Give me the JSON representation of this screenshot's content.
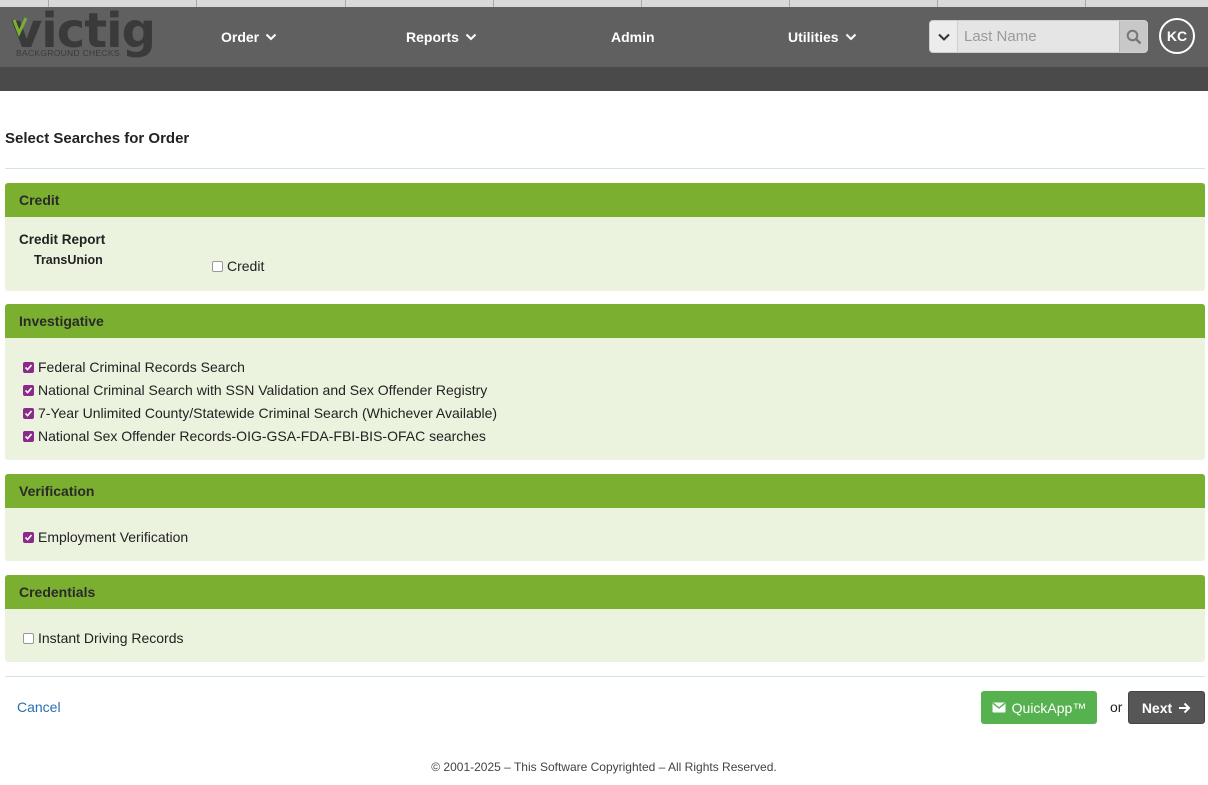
{
  "header": {
    "logo_word": "victig",
    "logo_tagline": "BACKGROUND CHECKS",
    "nav": [
      {
        "label": "Order",
        "has_menu": true
      },
      {
        "label": "Reports",
        "has_menu": true
      },
      {
        "label": "Admin",
        "has_menu": false
      },
      {
        "label": "Utilities",
        "has_menu": true
      }
    ],
    "search": {
      "placeholder": "Last Name",
      "value": ""
    },
    "avatar_initials": "KC"
  },
  "page": {
    "title": "Select Searches for Order"
  },
  "sections": {
    "credit": {
      "title": "Credit",
      "group_label": "Credit Report",
      "provider": "TransUnion",
      "option": {
        "label": "Credit",
        "checked": false
      }
    },
    "investigative": {
      "title": "Investigative",
      "items": [
        {
          "label": "Federal Criminal Records Search",
          "checked": true
        },
        {
          "label": "National Criminal Search with SSN Validation and Sex Offender Registry",
          "checked": true
        },
        {
          "label": "7-Year Unlimited County/Statewide Criminal Search (Whichever Available)",
          "checked": true
        },
        {
          "label": "National Sex Offender Records-OIG-GSA-FDA-FBI-BIS-OFAC searches",
          "checked": true
        }
      ]
    },
    "verification": {
      "title": "Verification",
      "items": [
        {
          "label": "Employment Verification",
          "checked": true
        }
      ]
    },
    "credentials": {
      "title": "Credentials",
      "items": [
        {
          "label": "Instant Driving Records",
          "checked": false
        }
      ]
    }
  },
  "actions": {
    "cancel_label": "Cancel",
    "quickapp_label": "QuickApp™",
    "or_label": "or",
    "next_label": "Next"
  },
  "footer": {
    "copyright": "© 2001-2025 – This Software Copyrighted – All Rights Reserved."
  },
  "colors": {
    "header_bg": "#606060",
    "section_head": "#7aaf30",
    "section_body": "#ebf3df",
    "checkbox_checked": "#8b2a8b",
    "quickapp_bg": "#56b14f",
    "next_bg": "#565656",
    "link": "#2a6eb0"
  },
  "icons": {
    "nav_menu": "chevron-down-icon",
    "search": "search-icon",
    "search_dropdown": "chevron-down-icon",
    "quickapp": "envelope-icon",
    "next": "arrow-right-icon",
    "checkbox_on": "check-icon"
  }
}
